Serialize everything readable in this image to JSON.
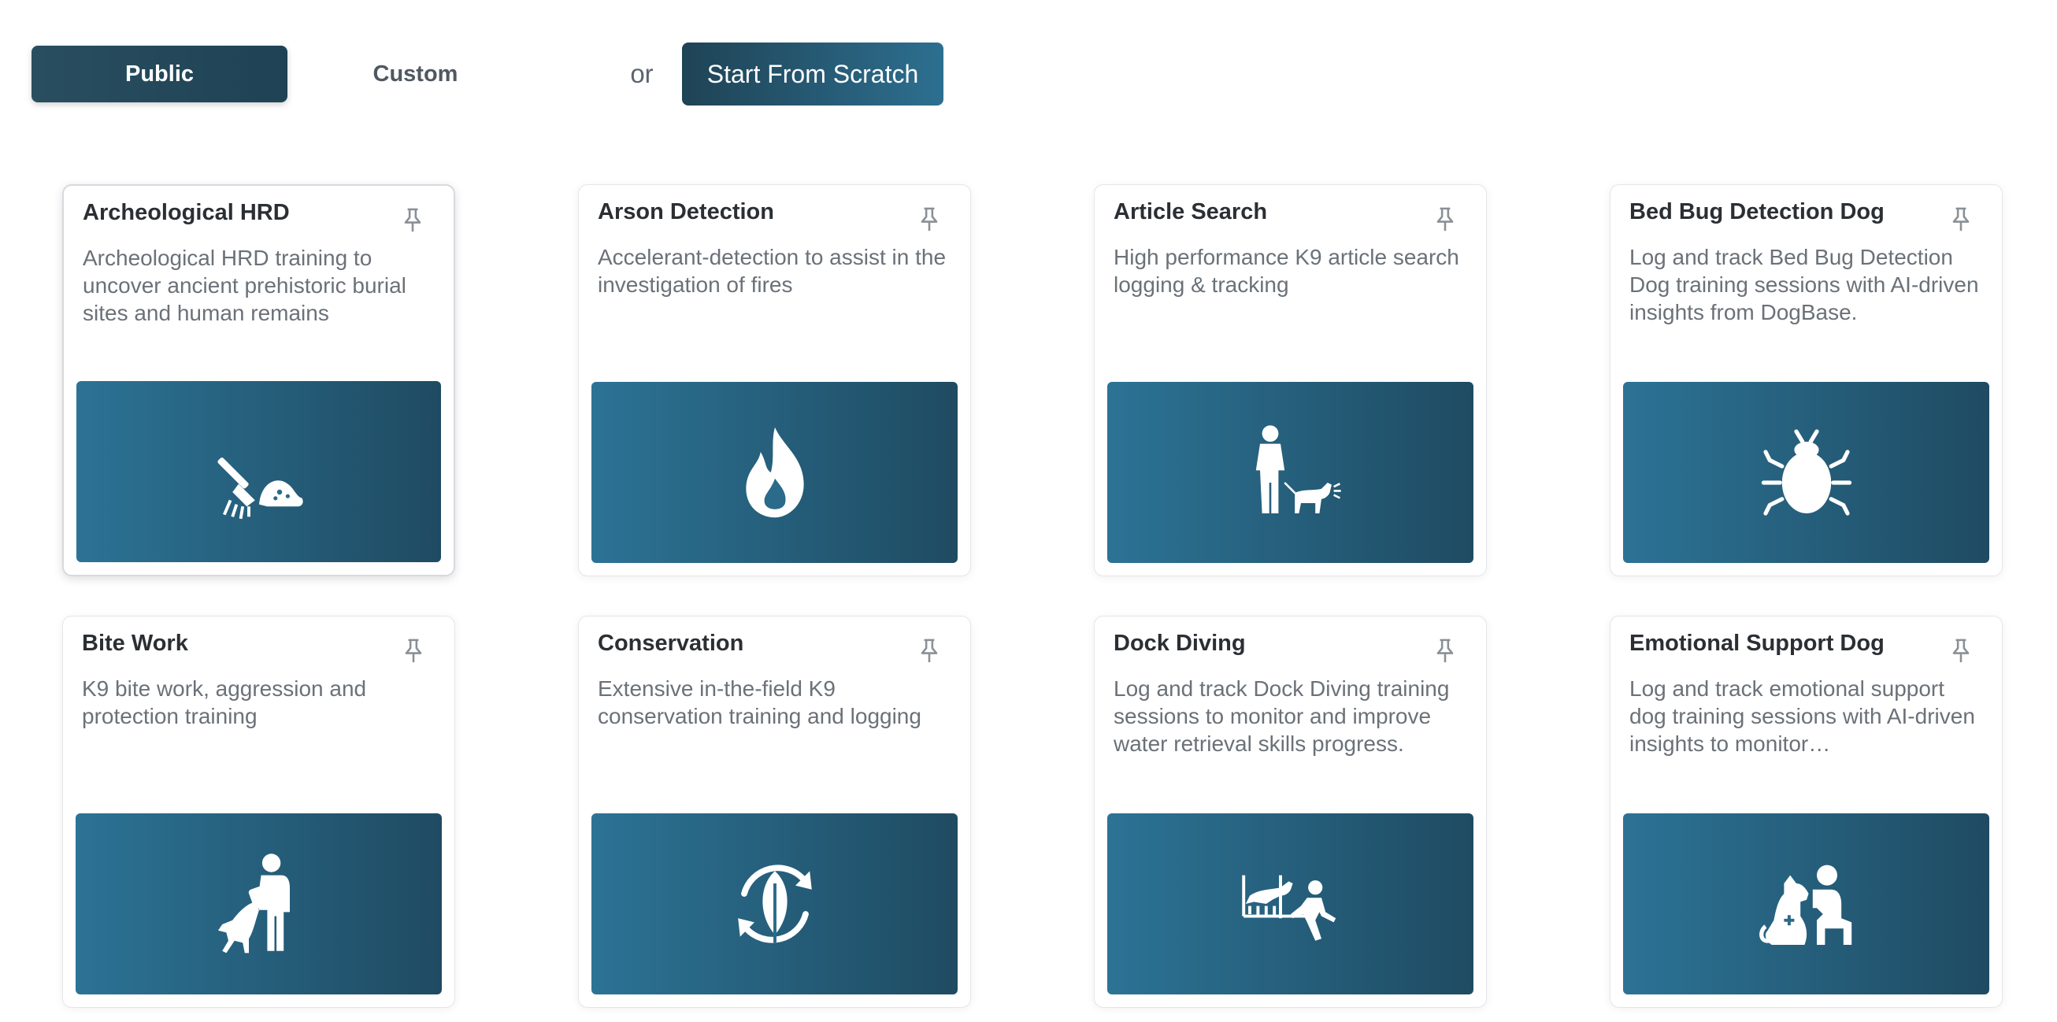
{
  "tabs": {
    "public_label": "Public",
    "custom_label": "Custom",
    "or_label": "or",
    "scratch_label": "Start From Scratch"
  },
  "colors": {
    "primary_dark": "#1f4355",
    "primary_light": "#2c7395"
  },
  "cards": [
    {
      "title": "Archeological HRD",
      "description": "Archeological HRD training to uncover ancient prehistoric burial sites and human remains",
      "icon": "archeology-brush-icon"
    },
    {
      "title": "Arson Detection",
      "description": "Accelerant-detection to assist in the investigation of fires",
      "icon": "fire-icon"
    },
    {
      "title": "Article Search",
      "description": "High performance K9 article search logging & tracking",
      "icon": "handler-with-dog-icon"
    },
    {
      "title": "Bed Bug Detection Dog",
      "description": "Log and track Bed Bug Detection Dog training sessions with AI-driven insights from DogBase.",
      "icon": "bug-icon"
    },
    {
      "title": "Bite Work",
      "description": "K9 bite work, aggression and protection training",
      "icon": "bite-work-icon"
    },
    {
      "title": "Conservation",
      "description": "Extensive in-the-field K9 conservation training and logging",
      "icon": "leaf-cycle-icon"
    },
    {
      "title": "Dock Diving",
      "description": "Log and track Dock Diving training sessions to monitor and improve water retrieval skills progress.",
      "icon": "dock-diving-icon"
    },
    {
      "title": "Emotional Support Dog",
      "description": "Log and track emotional support dog training sessions with AI-driven insights to monitor…",
      "icon": "support-dog-icon"
    }
  ]
}
